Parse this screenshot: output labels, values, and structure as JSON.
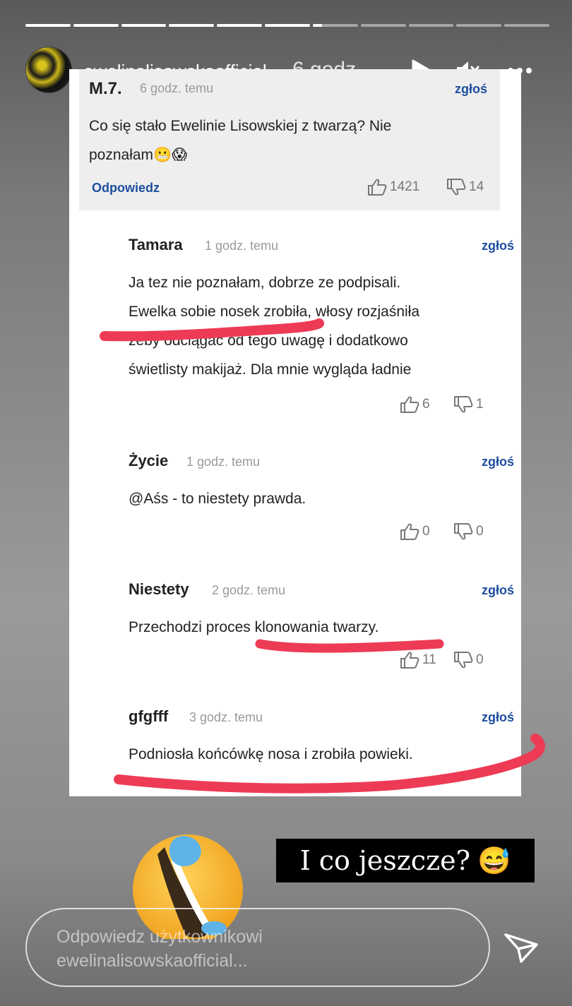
{
  "story": {
    "progress_segments": [
      1,
      1,
      1,
      1,
      1,
      1,
      0.2,
      0,
      0,
      0,
      0
    ],
    "username": "ewelinalisowskaofficial",
    "time": "6 godz.",
    "icons": [
      "play-icon",
      "mute-icon",
      "more-icon"
    ]
  },
  "comments": {
    "top": {
      "author": "M.7.",
      "meta": "6 godz. temu",
      "report": "zgłoś",
      "text_line1": "Co się stało Ewelinie Lisowskiej z twarzą? Nie",
      "text_line2": "poznałam😬😱",
      "reply_label": "Odpowiedz",
      "likes": "1421",
      "dislikes": "14"
    },
    "replies": [
      {
        "author": "Tamara",
        "meta": "1 godz. temu",
        "report": "zgłoś",
        "lines": [
          "Ja tez nie poznałam, dobrze ze podpisali.",
          "Ewelka sobie nosek zrobiła, włosy rozjaśniła",
          "żeby odciągać od tego uwagę i dodatkowo",
          "świetlisty makijaż. Dla mnie wygląda ładnie"
        ],
        "likes": "6",
        "dislikes": "1"
      },
      {
        "author": "Życie",
        "meta": "1 godz. temu",
        "report": "zgłoś",
        "lines": [
          "@Aśs - to niestety prawda."
        ],
        "likes": "0",
        "dislikes": "0"
      },
      {
        "author": "Niestety",
        "meta": "2 godz. temu",
        "report": "zgłoś",
        "lines": [
          "Przechodzi proces klonowania twarzy."
        ],
        "likes": "11",
        "dislikes": "0"
      },
      {
        "author": "gfgfff",
        "meta": "3 godz. temu",
        "report": "zgłoś",
        "lines": [
          "Podniosła końcówkę nosa i zrobiła powieki."
        ],
        "likes": "",
        "dislikes": ""
      }
    ]
  },
  "caption": {
    "text": "I co jeszcze?",
    "emoji": "😅"
  },
  "reply_input": {
    "placeholder_line1": "Odpowiedz użytkownikowi",
    "placeholder_line2": "ewelinalisowskaofficial..."
  },
  "colors": {
    "link_blue": "#1d4e9e",
    "marker_red": "#ee3b55"
  }
}
